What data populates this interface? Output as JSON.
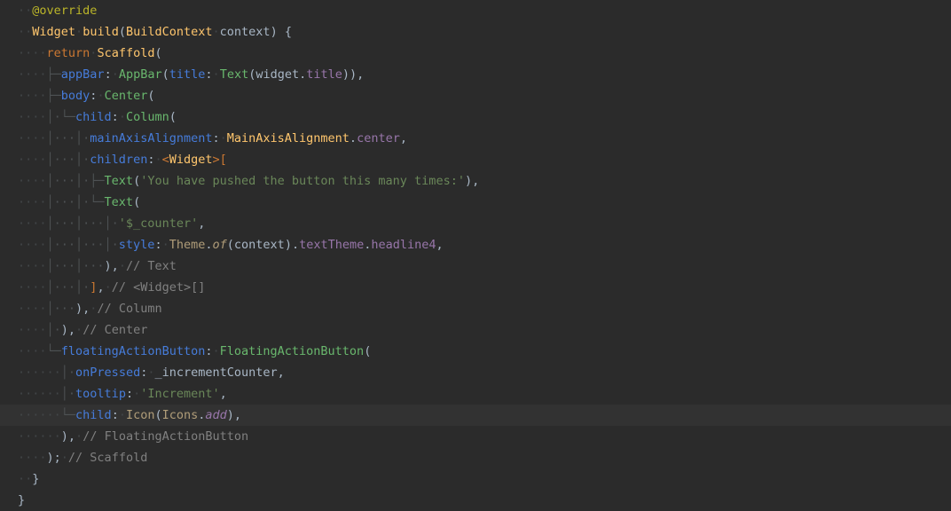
{
  "code": {
    "annotation_override": "@override",
    "kw_return": "return",
    "ty_Widget": "Widget",
    "ty_BuildContext": "BuildContext",
    "id_build": "build",
    "id_context": "context",
    "ty_Scaffold": "Scaffold",
    "prop_appBar": "appBar",
    "call_AppBar": "AppBar",
    "prop_title": "title",
    "call_Text": "Text",
    "id_widget": "widget",
    "mem_title": "title",
    "prop_body": "body",
    "call_Center": "Center",
    "prop_child": "child",
    "call_Column": "Column",
    "prop_mainAxisAlignment": "mainAxisAlignment",
    "ty_MainAxisAlignment": "MainAxisAlignment",
    "mem_center": "center",
    "prop_children": "children",
    "str_pushed": "'You have pushed the button this many times:'",
    "str_counter": "'$_counter'",
    "prop_style": "style",
    "id_Theme": "Theme",
    "id_of": "of",
    "mem_textTheme": "textTheme",
    "mem_headline4": "headline4",
    "cmt_Text": "// Text",
    "cmt_WidgetArr": "// <Widget>[]",
    "cmt_Column": "// Column",
    "cmt_Center": "// Center",
    "prop_floatingActionButton": "floatingActionButton",
    "call_FloatingActionButton": "FloatingActionButton",
    "prop_onPressed": "onPressed",
    "id_incrementCounter": "_incrementCounter",
    "prop_tooltip": "tooltip",
    "str_Increment": "'Increment'",
    "call_Icon": "Icon",
    "id_Icons": "Icons",
    "mem_add": "add",
    "cmt_FAB": "// FloatingActionButton",
    "cmt_Scaffold": "// Scaffold"
  }
}
